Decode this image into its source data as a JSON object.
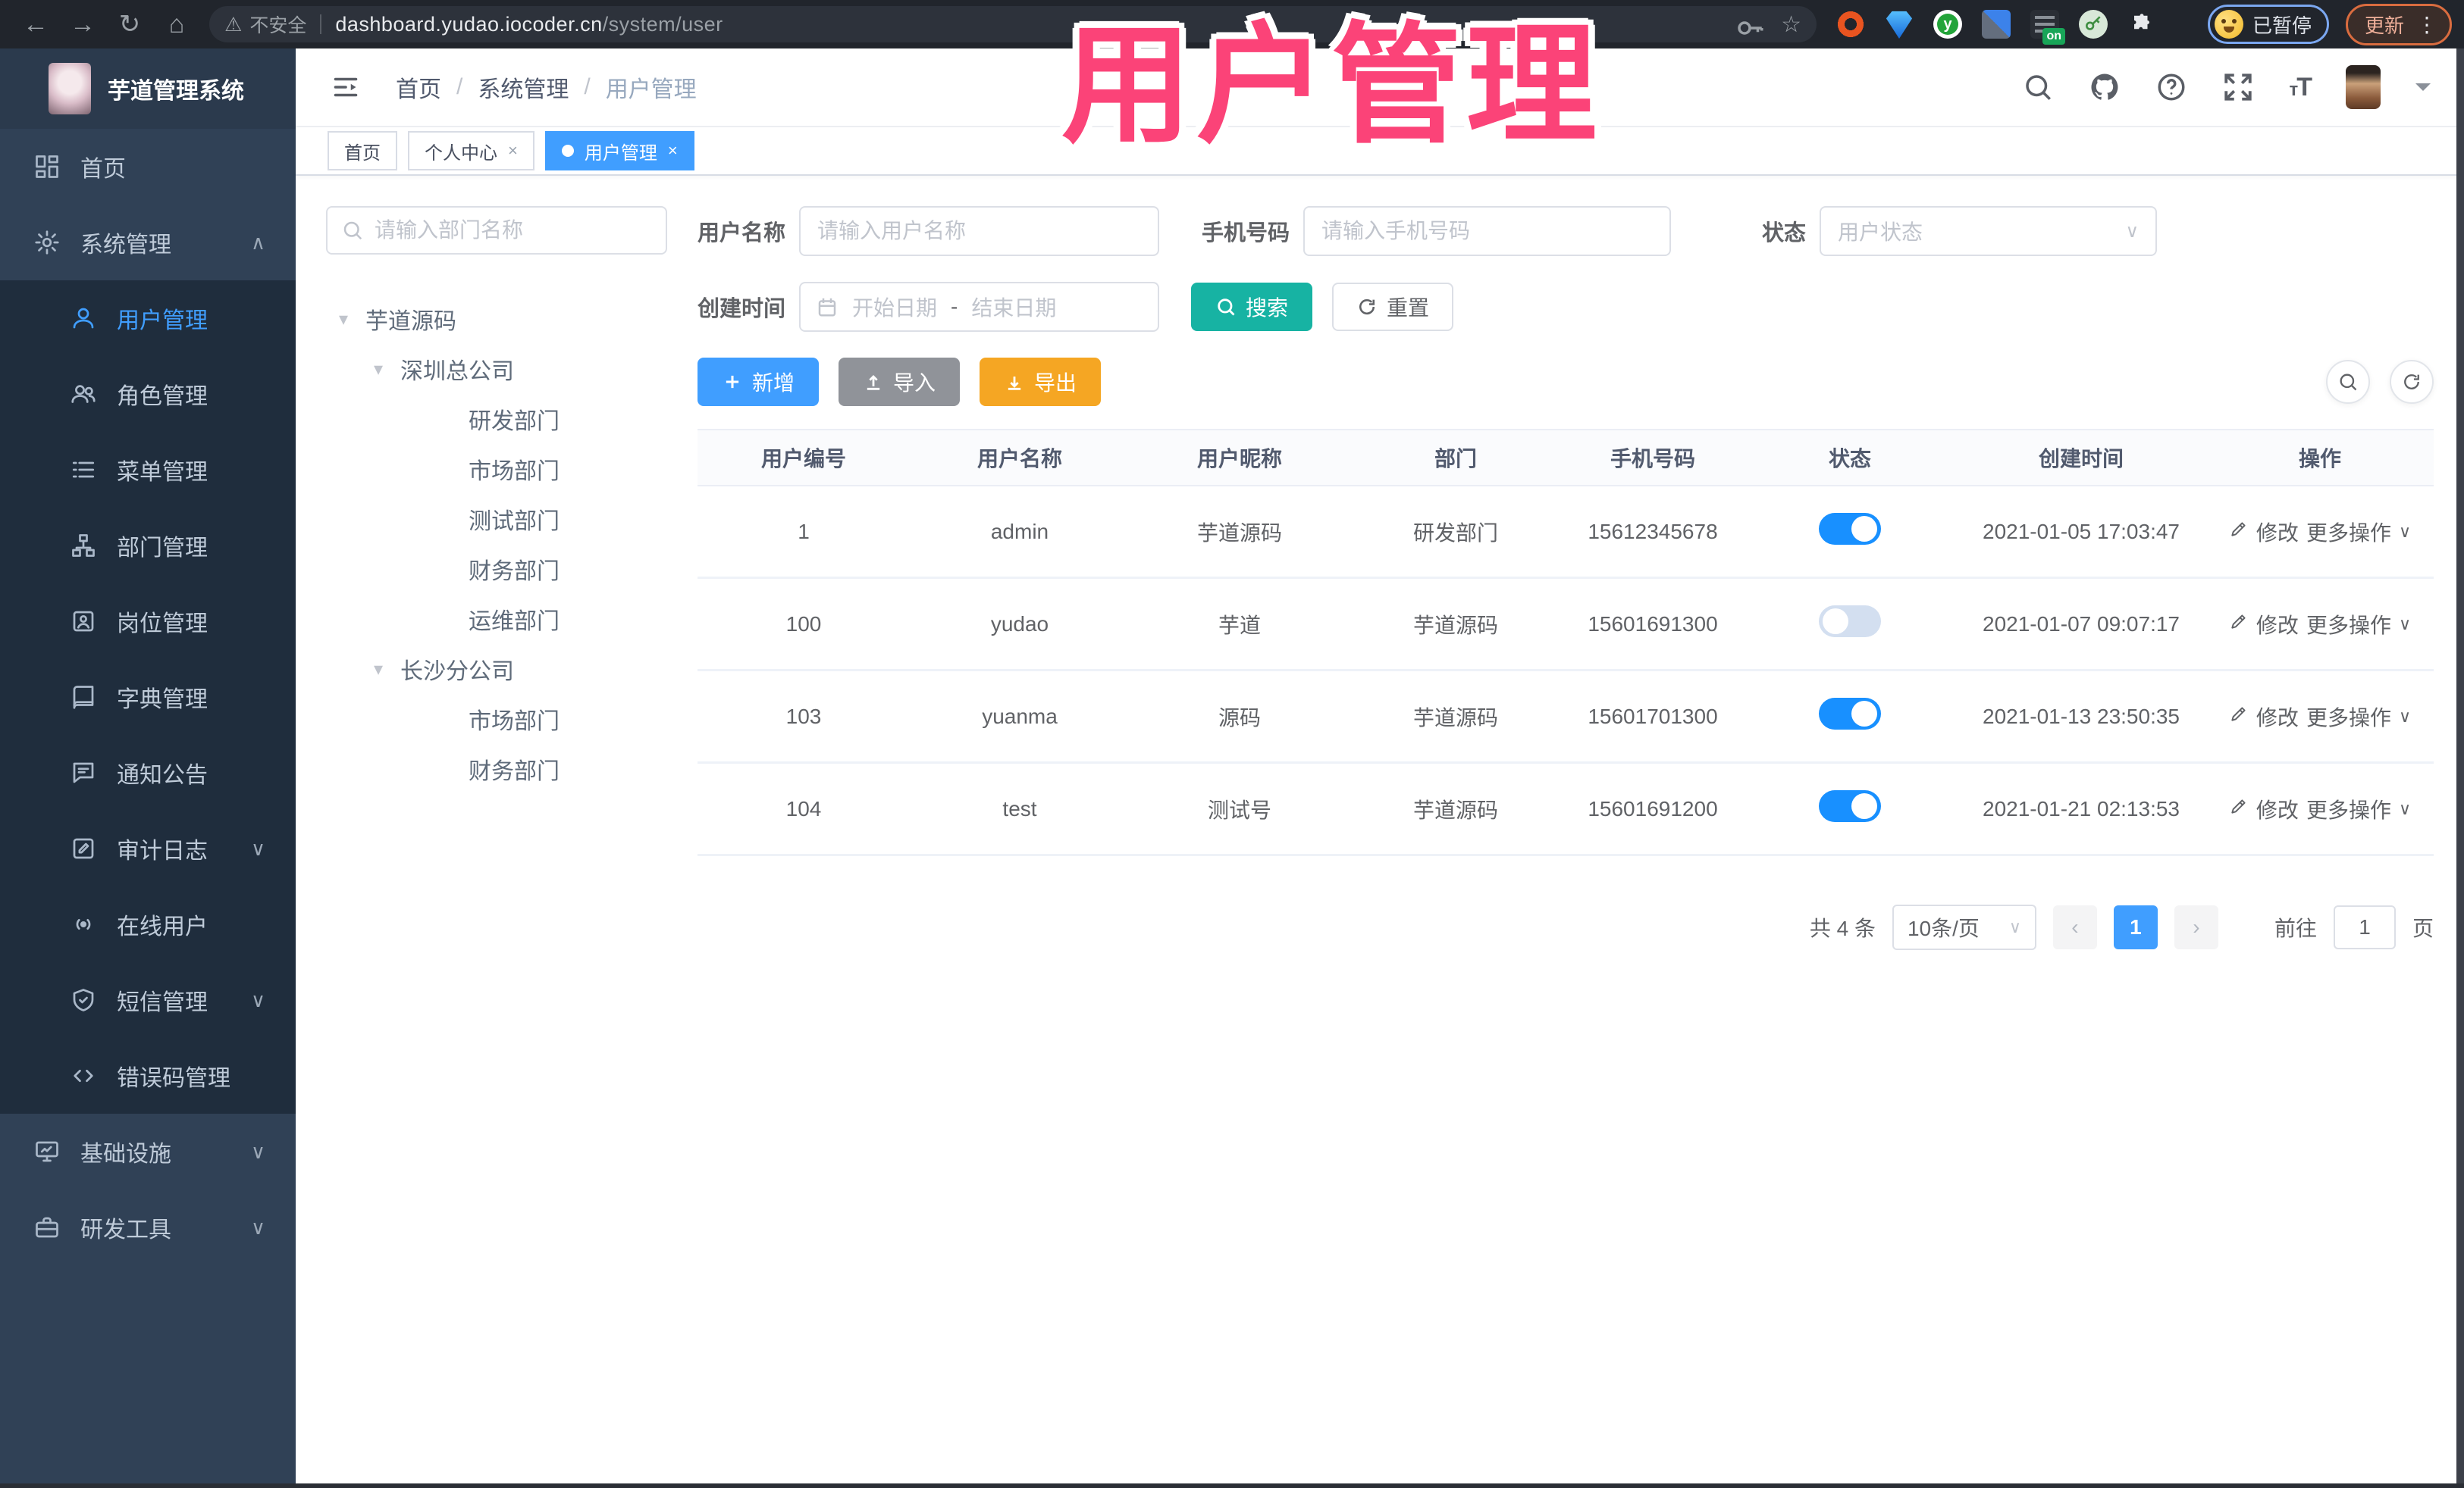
{
  "browser": {
    "security_label": "不安全",
    "url_host": "dashboard.yudao.iocoder.cn",
    "url_path": "/system/user",
    "extension_badge": "on",
    "extension_y": "y",
    "profile_label": "已暂停",
    "update_label": "更新"
  },
  "overlay": {
    "title": "用户管理",
    "color": "#fb4378"
  },
  "sidebar": {
    "logo_title": "芋道管理系统",
    "items": [
      {
        "key": "home",
        "label": "首页",
        "icon": "dashboard",
        "type": "root"
      },
      {
        "key": "system-management",
        "label": "系统管理",
        "icon": "gear",
        "type": "root",
        "chevron": "up"
      },
      {
        "key": "user-management",
        "label": "用户管理",
        "icon": "user",
        "type": "sub",
        "active": true
      },
      {
        "key": "role-management",
        "label": "角色管理",
        "icon": "users",
        "type": "sub"
      },
      {
        "key": "menu-management",
        "label": "菜单管理",
        "icon": "list",
        "type": "sub"
      },
      {
        "key": "dept-management",
        "label": "部门管理",
        "icon": "org",
        "type": "sub"
      },
      {
        "key": "post-management",
        "label": "岗位管理",
        "icon": "badge",
        "type": "sub"
      },
      {
        "key": "dict-management",
        "label": "字典管理",
        "icon": "book",
        "type": "sub"
      },
      {
        "key": "notice",
        "label": "通知公告",
        "icon": "chat",
        "type": "sub"
      },
      {
        "key": "audit-log",
        "label": "审计日志",
        "icon": "edit",
        "type": "sub",
        "chevron": "down"
      },
      {
        "key": "online-users",
        "label": "在线用户",
        "icon": "online",
        "type": "sub"
      },
      {
        "key": "sms-management",
        "label": "短信管理",
        "icon": "shield",
        "type": "sub",
        "chevron": "down"
      },
      {
        "key": "error-code-management",
        "label": "错误码管理",
        "icon": "code",
        "type": "sub"
      },
      {
        "key": "infrastructure",
        "label": "基础设施",
        "icon": "monitor",
        "type": "root",
        "chevron": "down"
      },
      {
        "key": "dev-tools",
        "label": "研发工具",
        "icon": "tool",
        "type": "root",
        "chevron": "down"
      }
    ]
  },
  "header": {
    "breadcrumb": [
      "首页",
      "系统管理",
      "用户管理"
    ]
  },
  "tabs": [
    {
      "label": "首页",
      "closable": false,
      "active": false
    },
    {
      "label": "个人中心",
      "closable": true,
      "active": false
    },
    {
      "label": "用户管理",
      "closable": true,
      "active": true
    }
  ],
  "content": {
    "dept_search_placeholder": "请输入部门名称",
    "dept_tree": [
      {
        "label": "芋道源码",
        "level": 0,
        "caret": true
      },
      {
        "label": "深圳总公司",
        "level": 1,
        "caret": true
      },
      {
        "label": "研发部门",
        "level": 2,
        "caret": false
      },
      {
        "label": "市场部门",
        "level": 2,
        "caret": false
      },
      {
        "label": "测试部门",
        "level": 2,
        "caret": false
      },
      {
        "label": "财务部门",
        "level": 2,
        "caret": false
      },
      {
        "label": "运维部门",
        "level": 2,
        "caret": false
      },
      {
        "label": "长沙分公司",
        "level": 1,
        "caret": true
      },
      {
        "label": "市场部门",
        "level": 2,
        "caret": false
      },
      {
        "label": "财务部门",
        "level": 2,
        "caret": false
      }
    ],
    "filters": {
      "username_label": "用户名称",
      "username_placeholder": "请输入用户名称",
      "mobile_label": "手机号码",
      "mobile_placeholder": "请输入手机号码",
      "status_label": "状态",
      "status_placeholder": "用户状态",
      "date_label": "创建时间",
      "date_start_placeholder": "开始日期",
      "date_separator": "-",
      "date_end_placeholder": "结束日期",
      "search_label": "搜索",
      "reset_label": "重置"
    },
    "toolbar": {
      "add_label": "新增",
      "import_label": "导入",
      "export_label": "导出"
    },
    "table": {
      "columns": [
        "用户编号",
        "用户名称",
        "用户昵称",
        "部门",
        "手机号码",
        "状态",
        "创建时间",
        "操作"
      ],
      "action_edit": "修改",
      "action_more": "更多操作",
      "rows": [
        {
          "id": "1",
          "username": "admin",
          "nickname": "芋道源码",
          "dept": "研发部门",
          "mobile": "15612345678",
          "status_on": true,
          "created": "2021-01-05 17:03:47"
        },
        {
          "id": "100",
          "username": "yudao",
          "nickname": "芋道",
          "dept": "芋道源码",
          "mobile": "15601691300",
          "status_on": false,
          "created": "2021-01-07 09:07:17"
        },
        {
          "id": "103",
          "username": "yuanma",
          "nickname": "源码",
          "dept": "芋道源码",
          "mobile": "15601701300",
          "status_on": true,
          "created": "2021-01-13 23:50:35"
        },
        {
          "id": "104",
          "username": "test",
          "nickname": "测试号",
          "dept": "芋道源码",
          "mobile": "15601691200",
          "status_on": true,
          "created": "2021-01-21 02:13:53"
        }
      ]
    },
    "pagination": {
      "total_text": "共 4 条",
      "page_size": "10条/页",
      "prev": "‹",
      "next": "›",
      "current_page": "1",
      "goto_label": "前往",
      "goto_value": "1",
      "page_unit": "页"
    }
  },
  "colors": {
    "accent": "#409eff",
    "search_button": "#17b3a3",
    "export_button": "#f5a623",
    "import_button": "#909399",
    "toggle_on": "#1890ff",
    "annotation": "#fb4378"
  }
}
